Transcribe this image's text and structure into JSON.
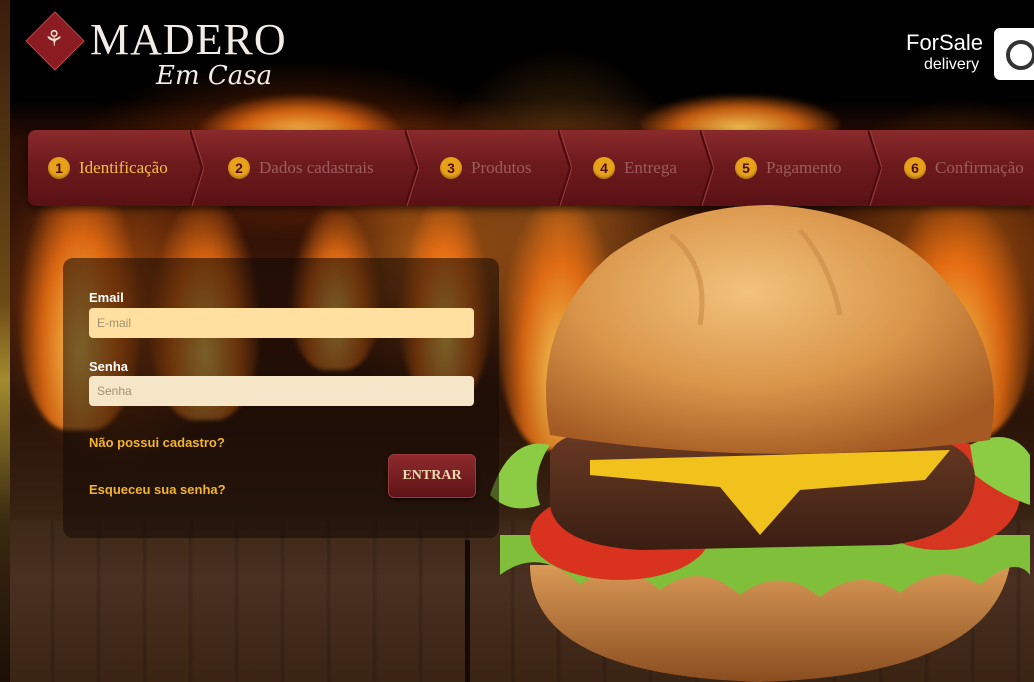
{
  "header": {
    "logo_title": "MADERO",
    "logo_subtitle": "Em Casa",
    "logo_icon": "tree-icon",
    "partner_name": "ForSale",
    "partner_sub": "delivery",
    "partner_icon": "camera-icon"
  },
  "steps": [
    {
      "num": "1",
      "label": "Identificação",
      "active": true
    },
    {
      "num": "2",
      "label": "Dados cadastrais",
      "active": false
    },
    {
      "num": "3",
      "label": "Produtos",
      "active": false
    },
    {
      "num": "4",
      "label": "Entrega",
      "active": false
    },
    {
      "num": "5",
      "label": "Pagamento",
      "active": false
    },
    {
      "num": "6",
      "label": "Confirmação",
      "active": false
    }
  ],
  "login": {
    "email_label": "Email",
    "email_placeholder": "E-mail",
    "password_label": "Senha",
    "password_placeholder": "Senha",
    "register_link": "Não possui cadastro?",
    "forgot_link": "Esqueceu sua senha?",
    "submit_label": "ENTRAR"
  },
  "colors": {
    "step_bar": "#6d1a1d",
    "active_step": "#f2c040",
    "step_badge": "#e8a21a",
    "link": "#f3b52a",
    "email_field": "#ffe0a0"
  }
}
